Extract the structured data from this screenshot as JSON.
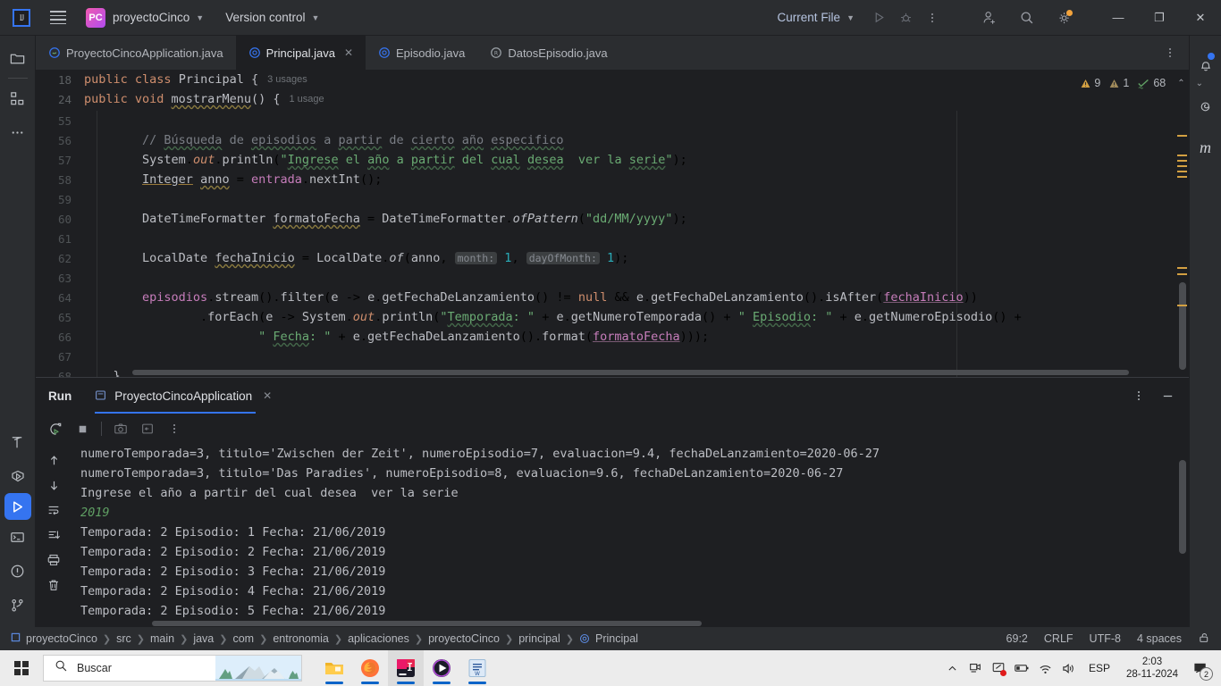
{
  "titlebar": {
    "logo_icon": "intellij-logo-icon",
    "menu_icon": "hamburger-menu-icon",
    "project_badge": "PC",
    "project_name": "proyectoCinco",
    "version_control": "Version control",
    "run_config": "Current File",
    "run_icon": "run-icon",
    "debug_icon": "debug-icon",
    "more_icon": "more-vertical-icon",
    "share_icon": "add-user-icon",
    "search_icon": "search-icon",
    "settings_icon": "gear-icon",
    "minimize": "—",
    "maximize": "❐",
    "close": "✕"
  },
  "left_rail": [
    {
      "name": "project-tool-icon",
      "label": "Project"
    },
    {
      "name": "structure-tool-icon",
      "label": "Structure"
    },
    {
      "name": "more-tool-windows-icon",
      "label": "More tool windows"
    },
    {
      "name": "build-tool-icon",
      "label": "Build"
    },
    {
      "name": "run-dashboard-icon",
      "label": "Services"
    },
    {
      "name": "run-tool-icon",
      "label": "Run"
    },
    {
      "name": "terminal-tool-icon",
      "label": "Terminal"
    },
    {
      "name": "problems-tool-icon",
      "label": "Problems"
    },
    {
      "name": "version-control-tool-icon",
      "label": "Version Control"
    }
  ],
  "right_rail": [
    {
      "name": "notifications-bell-icon",
      "label": "Notifications"
    },
    {
      "name": "ai-assistant-icon",
      "label": "AI Assistant"
    },
    {
      "name": "meet-new-ui-icon",
      "label": "m"
    }
  ],
  "editor_tabs": [
    {
      "label": "ProyectoCincoApplication.java",
      "icon": "java-spring-class-icon",
      "active": false,
      "closable": false
    },
    {
      "label": "Principal.java",
      "icon": "java-class-icon",
      "active": true,
      "closable": true
    },
    {
      "label": "Episodio.java",
      "icon": "java-class-icon",
      "active": false,
      "closable": false
    },
    {
      "label": "DatosEpisodio.java",
      "icon": "java-record-icon",
      "active": false,
      "closable": false
    }
  ],
  "tabstrip_more_icon": "more-vertical-icon",
  "sticky_lines": [
    {
      "num": "18",
      "code": "public class Principal {",
      "usages": "3 usages"
    },
    {
      "num": "24",
      "code": "    public void mostrarMenu() {",
      "usages": "1 usage"
    }
  ],
  "inspection_widget": {
    "warnings": "9",
    "weak_warnings": "1",
    "typos": "68",
    "up_icon": "chevron-up-icon",
    "down_icon": "chevron-down-icon"
  },
  "code_lines": [
    {
      "num": "55",
      "text": ""
    },
    {
      "num": "56",
      "text": "        // Búsqueda de episodios a partir de cierto año especifico"
    },
    {
      "num": "57",
      "text": "        System.out.println(\"Ingrese el año a partir del cual desea  ver la serie\");"
    },
    {
      "num": "58",
      "text": "        Integer anno = entrada.nextInt();"
    },
    {
      "num": "59",
      "text": ""
    },
    {
      "num": "60",
      "text": "        DateTimeFormatter formatoFecha = DateTimeFormatter.ofPattern(\"dd/MM/yyyy\");"
    },
    {
      "num": "61",
      "text": ""
    },
    {
      "num": "62",
      "text": "        LocalDate fechaInicio = LocalDate.of(anno, month: 1, dayOfMonth: 1);"
    },
    {
      "num": "63",
      "text": ""
    },
    {
      "num": "64",
      "text": "        episodios.stream().filter(e -> e.getFechaDeLanzamiento() != null && e.getFechaDeLanzamiento().isAfter(fechaInicio))"
    },
    {
      "num": "65",
      "text": "                .forEach(e -> System.out.println(\"Temporada: \" + e.getNumeroTemporada() + \" Episodio: \" + e.getNumeroEpisodio() +"
    },
    {
      "num": "66",
      "text": "                        \" Fecha: \" + e.getFechaDeLanzamiento().format(formatoFecha)));"
    },
    {
      "num": "67",
      "text": ""
    },
    {
      "num": "68",
      "text": "    }"
    }
  ],
  "run_panel": {
    "title": "Run",
    "tab_label": "ProyectoCincoApplication",
    "tab_icon": "run-config-icon",
    "tab_close": "✕",
    "options_icon": "more-vertical-icon",
    "hide_icon": "minimize-panel-icon",
    "toolbar": [
      {
        "name": "rerun-icon",
        "label": "Rerun"
      },
      {
        "name": "stop-icon",
        "label": "Stop"
      },
      {
        "name": "screenshot-icon",
        "label": "Screenshot"
      },
      {
        "name": "soft-wrap-icon",
        "label": "Soft-Wrap"
      },
      {
        "name": "more-vertical-icon",
        "label": "More"
      }
    ],
    "side_toolbar": [
      {
        "name": "up-arrow-icon",
        "label": "Previous occurrence"
      },
      {
        "name": "down-arrow-icon",
        "label": "Next occurrence"
      },
      {
        "name": "soft-wrap-icon",
        "label": "Soft-Wrap"
      },
      {
        "name": "scroll-to-end-icon",
        "label": "Scroll to end"
      },
      {
        "name": "print-icon",
        "label": "Print"
      },
      {
        "name": "trash-icon",
        "label": "Clear all"
      }
    ],
    "console_lines": [
      {
        "text": "numeroTemporada=3, titulo='Zwischen der Zeit', numeroEpisodio=7, evaluacion=9.4, fechaDeLanzamiento=2020-06-27",
        "kind": "out"
      },
      {
        "text": "numeroTemporada=3, titulo='Das Paradies', numeroEpisodio=8, evaluacion=9.6, fechaDeLanzamiento=2020-06-27",
        "kind": "out"
      },
      {
        "text": "Ingrese el año a partir del cual desea  ver la serie",
        "kind": "out"
      },
      {
        "text": "2019",
        "kind": "input"
      },
      {
        "text": "Temporada: 2 Episodio: 1 Fecha: 21/06/2019",
        "kind": "out"
      },
      {
        "text": "Temporada: 2 Episodio: 2 Fecha: 21/06/2019",
        "kind": "out"
      },
      {
        "text": "Temporada: 2 Episodio: 3 Fecha: 21/06/2019",
        "kind": "out"
      },
      {
        "text": "Temporada: 2 Episodio: 4 Fecha: 21/06/2019",
        "kind": "out"
      },
      {
        "text": "Temporada: 2 Episodio: 5 Fecha: 21/06/2019",
        "kind": "out"
      }
    ]
  },
  "statusbar": {
    "breadcrumbs": [
      "proyectoCinco",
      "src",
      "main",
      "java",
      "com",
      "entronomia",
      "aplicaciones",
      "proyectoCinco",
      "principal",
      "Principal"
    ],
    "caret": "69:2",
    "line_separator": "CRLF",
    "encoding": "UTF-8",
    "indent": "4 spaces",
    "lock_icon": "unlocked-padlock-icon"
  },
  "taskbar": {
    "start_icon": "windows-start-icon",
    "search_placeholder": "Buscar",
    "search_icon": "magnifier-icon",
    "apps": [
      {
        "name": "file-explorer-icon",
        "active": false,
        "running": true
      },
      {
        "name": "firefox-icon",
        "active": false,
        "running": true
      },
      {
        "name": "intellij-idea-icon",
        "active": true,
        "running": true
      },
      {
        "name": "media-player-icon",
        "active": false,
        "running": true
      },
      {
        "name": "word-icon",
        "active": false,
        "running": true
      }
    ],
    "tray": [
      {
        "name": "show-hidden-icons-chevron-icon"
      },
      {
        "name": "camera-icon"
      },
      {
        "name": "screen-share-icon"
      },
      {
        "name": "battery-icon"
      },
      {
        "name": "wifi-icon"
      },
      {
        "name": "volume-icon"
      }
    ],
    "language": "ESP",
    "time": "2:03",
    "date": "28-11-2024",
    "notification_icon": "notification-center-icon",
    "notification_count": "2"
  },
  "colors": {
    "accent": "#3574f0",
    "warning": "#d3a042",
    "string": "#6aab73",
    "keyword": "#cf8e6d",
    "field": "#c77dbb",
    "number": "#2aacb8",
    "comment": "#7a7e85"
  }
}
